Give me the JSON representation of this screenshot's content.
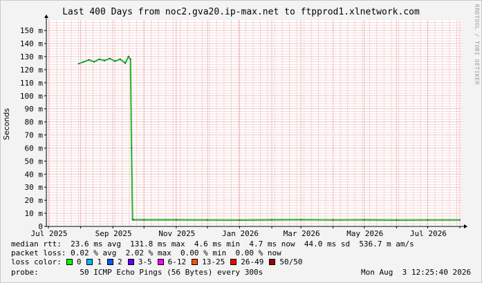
{
  "chart_data": {
    "type": "line",
    "title": "Last 400 Days from noc2.gva20.ip-max.net to ftpprod1.xlnetwork.com",
    "ylabel": "Seconds",
    "xlabel": "",
    "ylim": [
      0,
      158
    ],
    "yticks": [
      0,
      10,
      20,
      30,
      40,
      50,
      60,
      70,
      80,
      90,
      100,
      110,
      120,
      130,
      140,
      150
    ],
    "ytick_labels": [
      "0",
      "10 m",
      "20 m",
      "30 m",
      "40 m",
      "50 m",
      "60 m",
      "70 m",
      "80 m",
      "90 m",
      "100 m",
      "110 m",
      "120 m",
      "130 m",
      "140 m",
      "150 m"
    ],
    "xticks": [
      "Jul 2025",
      "Sep 2025",
      "Nov 2025",
      "Jan 2026",
      "Mar 2026",
      "May 2026",
      "Jul 2026"
    ],
    "xlim": [
      "2025-06-29",
      "2026-08-03"
    ],
    "grid": true,
    "series": [
      {
        "color": "#00cc00",
        "x": [
          "2025-07-30",
          "2025-08-04",
          "2025-08-09",
          "2025-08-14",
          "2025-08-19",
          "2025-08-24",
          "2025-08-29",
          "2025-09-03",
          "2025-09-08",
          "2025-09-13",
          "2025-09-16",
          "2025-09-18",
          "2025-09-19",
          "2025-09-20",
          "2025-09-21",
          "2025-10-01",
          "2025-11-01",
          "2025-12-01",
          "2026-01-01",
          "2026-02-01",
          "2026-03-01",
          "2026-04-01",
          "2026-05-01",
          "2026-06-01",
          "2026-07-01",
          "2026-08-01"
        ],
        "y": [
          124.5,
          126.0,
          127.5,
          126.0,
          128.0,
          127.0,
          128.5,
          126.5,
          128.0,
          125.0,
          130.0,
          128.0,
          60.0,
          5.2,
          5.0,
          5.0,
          5.0,
          4.9,
          4.8,
          5.0,
          5.1,
          4.9,
          5.0,
          4.8,
          4.9,
          4.9
        ]
      }
    ]
  },
  "stats": {
    "median_rtt": "median rtt:  23.6 ms avg  131.8 ms max  4.6 ms min  4.7 ms now  44.0 ms sd  536.7 m am/s",
    "packet_loss": "packet loss: 0.02 % avg  2.02 % max  0.00 % min  0.00 % now"
  },
  "loss_color": {
    "label": "loss color:",
    "items": [
      {
        "label": "0",
        "color": "#00ff00"
      },
      {
        "label": "1",
        "color": "#00b8ff"
      },
      {
        "label": "2",
        "color": "#0059ff"
      },
      {
        "label": "3-5",
        "color": "#5e00ff"
      },
      {
        "label": "6-12",
        "color": "#ff00ff"
      },
      {
        "label": "13-25",
        "color": "#ff5500"
      },
      {
        "label": "26-49",
        "color": "#ff0000"
      },
      {
        "label": "50/50",
        "color": "#a10000"
      }
    ]
  },
  "probe": {
    "text": "probe:         50 ICMP Echo Pings (56 Bytes) every 300s",
    "timestamp": "Mon Aug  3 12:25:40 2026"
  },
  "watermark": "RRDTOOL / TOBI OETIKER"
}
